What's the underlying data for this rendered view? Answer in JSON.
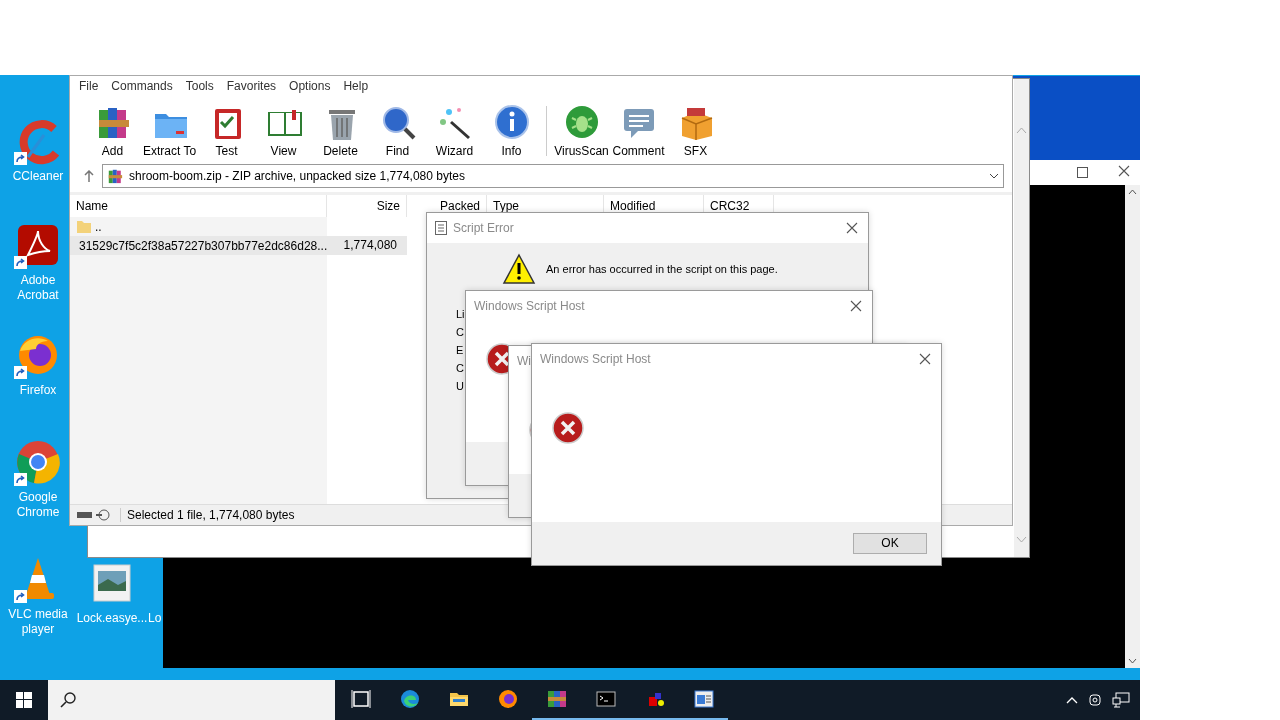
{
  "desktop_icons": [
    {
      "kind": "ccleaner",
      "label": "CCleaner",
      "shortcut": true
    },
    {
      "kind": "acrobat",
      "label": "Adobe Acrobat",
      "shortcut": true
    },
    {
      "kind": "firefox",
      "label": "Firefox",
      "shortcut": true
    },
    {
      "kind": "chrome",
      "label": "Google Chrome",
      "shortcut": true
    },
    {
      "kind": "vlc",
      "label": "VLC media player",
      "shortcut": true
    },
    {
      "kind": "image",
      "label": "Lock.easye...",
      "shortcut": false
    },
    {
      "kind": "none",
      "label": "Lo",
      "shortcut": false
    }
  ],
  "winrar": {
    "menu": [
      "File",
      "Commands",
      "Tools",
      "Favorites",
      "Options",
      "Help"
    ],
    "toolbar": [
      {
        "kind": "add",
        "label": "Add"
      },
      {
        "kind": "extract",
        "label": "Extract To"
      },
      {
        "kind": "test",
        "label": "Test"
      },
      {
        "kind": "view",
        "label": "View"
      },
      {
        "kind": "delete",
        "label": "Delete"
      },
      {
        "kind": "find",
        "label": "Find"
      },
      {
        "kind": "wizard",
        "label": "Wizard"
      },
      {
        "kind": "info",
        "label": "Info"
      },
      {
        "kind": "virusscan",
        "label": "VirusScan"
      },
      {
        "kind": "comment",
        "label": "Comment"
      },
      {
        "kind": "sfx",
        "label": "SFX"
      }
    ],
    "path": "shroom-boom.zip - ZIP archive, unpacked size 1,774,080 bytes",
    "columns": [
      "Name",
      "Size",
      "Packed",
      "Type",
      "Modified",
      "CRC32"
    ],
    "rows": [
      {
        "kind": "folder",
        "name": "..",
        "selected": false
      },
      {
        "kind": "file",
        "name": "31529c7f5c2f38a57227b307bb77e2dc86d28...",
        "size": "1,774,080",
        "selected": true
      }
    ],
    "status": "Selected 1 file, 1,774,080 bytes"
  },
  "script_error": {
    "title": "Script Error",
    "message": "An error has occurred in the script on this page.",
    "labels": [
      "Li",
      "C",
      "E",
      "C",
      "U"
    ]
  },
  "dialogs": [
    {
      "title": "Windows Script Host",
      "close_button": true
    },
    {
      "title": "Wi",
      "close_button": false
    },
    {
      "title": "Windows Script Host",
      "close_button": true,
      "button": "OK"
    }
  ],
  "taskbar": {
    "apps": [
      {
        "kind": "taskview",
        "running": false
      },
      {
        "kind": "edge",
        "running": false
      },
      {
        "kind": "explorer",
        "running": false
      },
      {
        "kind": "firefox",
        "running": false
      },
      {
        "kind": "winrar",
        "running": true
      },
      {
        "kind": "terminal",
        "running": true
      },
      {
        "kind": "blocks",
        "running": true
      },
      {
        "kind": "window",
        "running": true
      }
    ]
  }
}
